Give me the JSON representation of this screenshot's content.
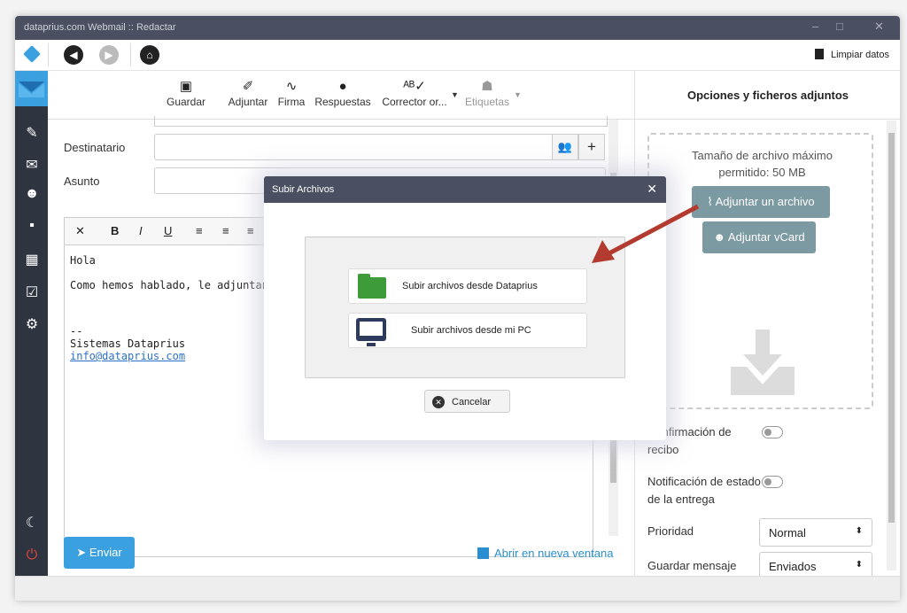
{
  "window": {
    "title": "dataprius.com Webmail :: Redactar",
    "clear_data_label": "Limpiar datos"
  },
  "toolbar": {
    "items": [
      {
        "label": "Guardar",
        "icon": "save-icon"
      },
      {
        "label": "Adjuntar",
        "icon": "paperclip-icon"
      },
      {
        "label": "Firma",
        "icon": "signature-icon"
      },
      {
        "label": "Respuestas",
        "icon": "comment-icon"
      },
      {
        "label": "Corrector or...",
        "icon": "spellcheck-icon"
      },
      {
        "label": "Etiquetas",
        "icon": "tags-icon"
      }
    ]
  },
  "compose": {
    "to_label": "Destinatario",
    "subject_label": "Asunto",
    "body_lines": [
      "Hola",
      "Como hemos hablado,  le adjuntan",
      "--",
      "Sistemas Dataprius",
      "info@dataprius.com"
    ],
    "send_label": "Enviar",
    "open_new_window_label": "Abrir en nueva ventana"
  },
  "right_panel": {
    "title": "Opciones y ficheros adjuntos",
    "max_size_text": "Tamaño de archivo máximo permitido: 50 MB",
    "attach_file_label": "Adjuntar un archivo",
    "attach_vcard_label": "Adjuntar vCard",
    "receipt_label": "Confirmación de recibo",
    "delivery_label": "Notificación de estado de la entrega",
    "priority_label": "Prioridad",
    "priority_value": "Normal",
    "save_label": "Guardar mensaje",
    "save_value": "Enviados"
  },
  "dialog": {
    "title": "Subir Archivos",
    "option_dataprius": "Subir archivos desde Dataprius",
    "option_pc": "Subir archivos desde mi PC",
    "cancel_label": "Cancelar"
  },
  "colors": {
    "titlebar": "#4a4f61",
    "sidebar": "#2e3440",
    "accent_blue": "#3aa0e0",
    "attach_button": "#7c9aa1",
    "arrow": "#b23a2e",
    "folder": "#3d9b3a"
  }
}
